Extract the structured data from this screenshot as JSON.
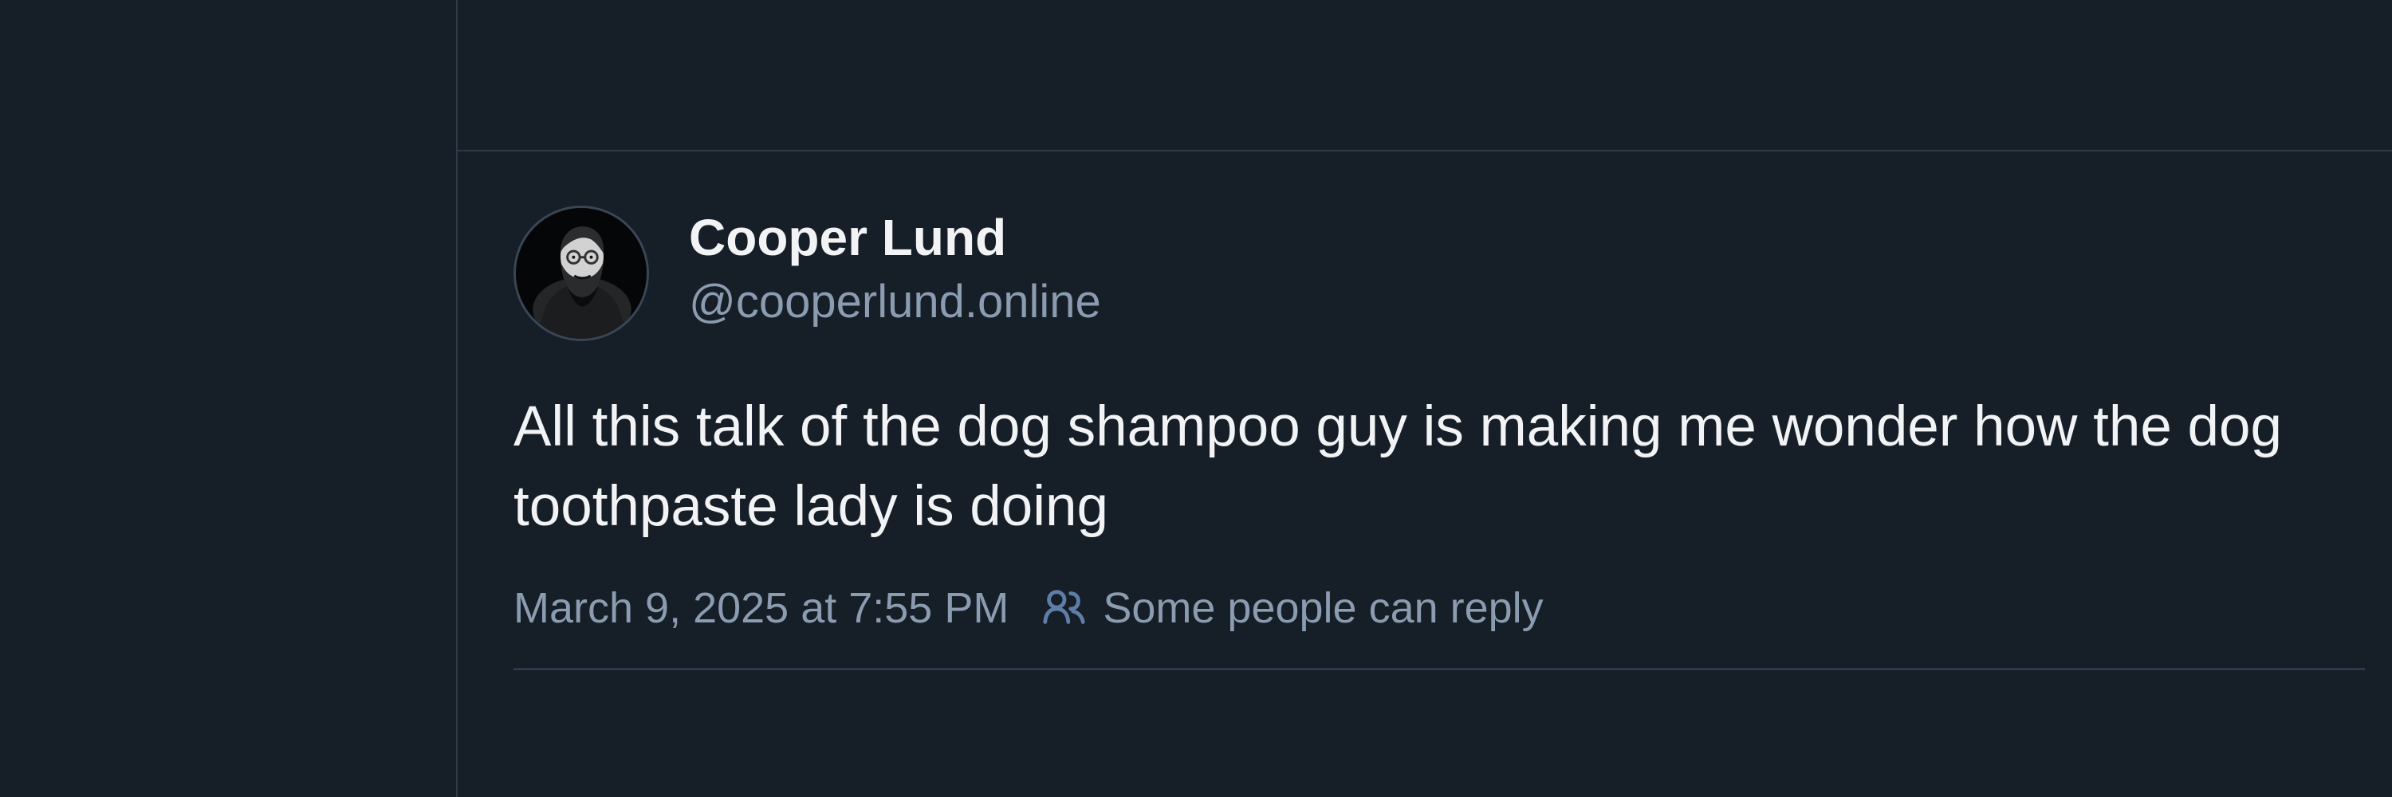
{
  "post": {
    "author": {
      "display_name": "Cooper Lund",
      "handle": "@cooperlund.online"
    },
    "text": "All this talk of the dog shampoo guy is making me wonder how the dog toothpaste lady is doing",
    "timestamp": "March 9, 2025 at 7:55 PM",
    "reply_setting": {
      "icon": "people-icon",
      "label": "Some people can reply"
    }
  },
  "colors": {
    "background": "#161e27",
    "border": "#2e3a47",
    "primary_text": "#f1f3f5",
    "secondary_text": "#8b9bb0"
  }
}
